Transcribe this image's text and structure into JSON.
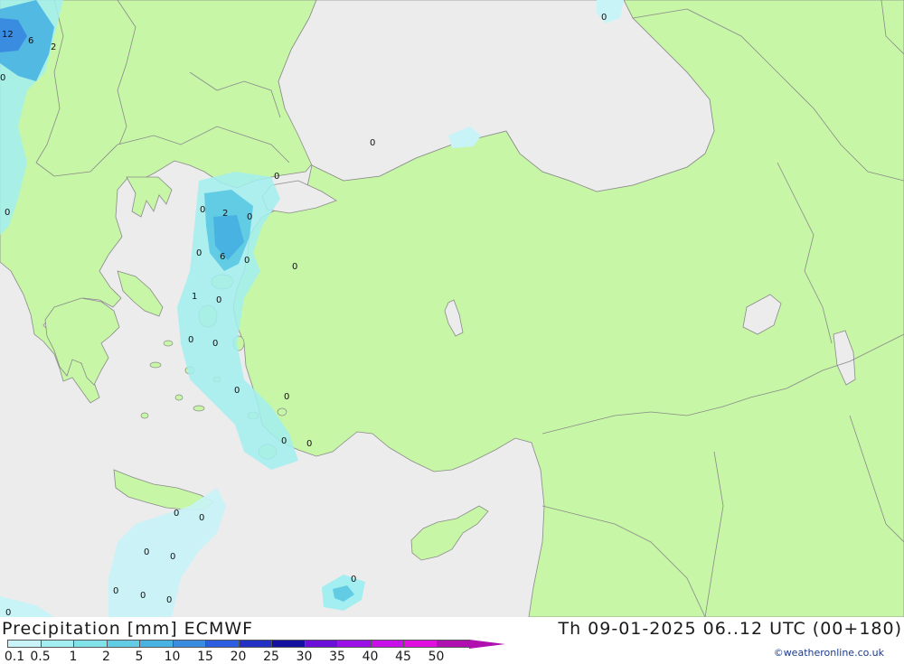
{
  "header": {
    "title": "Precipitation [mm] ECMWF",
    "valid_time": "Th 09-01-2025 06..12 UTC (00+180)"
  },
  "credit": "©weatheronline.co.uk",
  "legend": {
    "scale": [
      {
        "label": "0.1",
        "color": "#c8f4f8"
      },
      {
        "label": "0.5",
        "color": "#a2eef0"
      },
      {
        "label": "1",
        "color": "#82e2ea"
      },
      {
        "label": "2",
        "color": "#62cce4"
      },
      {
        "label": "5",
        "color": "#48b2e2"
      },
      {
        "label": "10",
        "color": "#3a8ce0"
      },
      {
        "label": "15",
        "color": "#2e5ee0"
      },
      {
        "label": "20",
        "color": "#2230c4"
      },
      {
        "label": "25",
        "color": "#1410a0"
      },
      {
        "label": "30",
        "color": "#6a10d8"
      },
      {
        "label": "35",
        "color": "#9a10e6"
      },
      {
        "label": "40",
        "color": "#c810e8"
      },
      {
        "label": "45",
        "color": "#e010e0"
      },
      {
        "label": "50",
        "color": "#b010b0"
      }
    ]
  },
  "map_labels": [
    {
      "id": "lbl-12",
      "text": "12"
    },
    {
      "id": "lbl-6a",
      "text": "6"
    },
    {
      "id": "lbl-2a",
      "text": "2"
    },
    {
      "id": "lbl-0a",
      "text": "0"
    },
    {
      "id": "lbl-0b",
      "text": "0"
    },
    {
      "id": "lbl-0c",
      "text": "0"
    },
    {
      "id": "lbl-0d",
      "text": "0"
    },
    {
      "id": "lbl-0e",
      "text": "0"
    },
    {
      "id": "lbl-0f",
      "text": "0"
    },
    {
      "id": "lbl-2b",
      "text": "2"
    },
    {
      "id": "lbl-0g",
      "text": "0"
    },
    {
      "id": "lbl-0h",
      "text": "0"
    },
    {
      "id": "lbl-6b",
      "text": "6"
    },
    {
      "id": "lbl-0i",
      "text": "0"
    },
    {
      "id": "lbl-0j",
      "text": "0"
    },
    {
      "id": "lbl-1a",
      "text": "1"
    },
    {
      "id": "lbl-0k",
      "text": "0"
    },
    {
      "id": "lbl-0l",
      "text": "0"
    },
    {
      "id": "lbl-0m",
      "text": "0"
    },
    {
      "id": "lbl-0n",
      "text": "0"
    },
    {
      "id": "lbl-0o",
      "text": "0"
    },
    {
      "id": "lbl-0p",
      "text": "0"
    },
    {
      "id": "lbl-0q",
      "text": "0"
    },
    {
      "id": "lbl-0r",
      "text": "0"
    },
    {
      "id": "lbl-0s",
      "text": "0"
    },
    {
      "id": "lbl-0t",
      "text": "0"
    },
    {
      "id": "lbl-0u",
      "text": "0"
    },
    {
      "id": "lbl-0v",
      "text": "0"
    },
    {
      "id": "lbl-0w",
      "text": "0"
    },
    {
      "id": "lbl-0x",
      "text": "0"
    },
    {
      "id": "lbl-0y",
      "text": "0"
    },
    {
      "id": "lbl-0z",
      "text": "0"
    }
  ]
}
